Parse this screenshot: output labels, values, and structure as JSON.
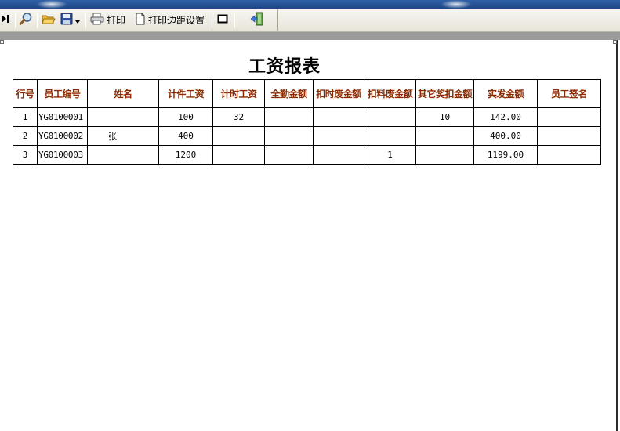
{
  "toolbar": {
    "print_label": "打印",
    "margin_label": "打印边距设置"
  },
  "report": {
    "title": "工资报表",
    "columns": [
      "行号",
      "员工编号",
      "姓名",
      "计件工资",
      "计时工资",
      "全勤金额",
      "扣时废金额",
      "扣料废金额",
      "其它奖扣金额",
      "实发金额",
      "员工签名"
    ],
    "rows": [
      [
        "1",
        "YG0100001",
        "",
        "100",
        "32",
        "",
        "",
        "",
        "10",
        "142.00",
        ""
      ],
      [
        "2",
        "YG0100002",
        "张",
        "400",
        "",
        "",
        "",
        "",
        "",
        "400.00",
        ""
      ],
      [
        "3",
        "YG0100003",
        "",
        "1200",
        "",
        "",
        "",
        "1",
        "",
        "1199.00",
        ""
      ]
    ]
  },
  "colors": {
    "header_text": "#8b2a00",
    "titlebar": "#2f5fa5"
  },
  "icons": [
    "last-page-icon",
    "zoom-icon",
    "open-folder-icon",
    "save-icon",
    "dropdown-arrow-icon",
    "printer-icon",
    "page-setup-icon",
    "single-page-icon",
    "exit-icon"
  ]
}
